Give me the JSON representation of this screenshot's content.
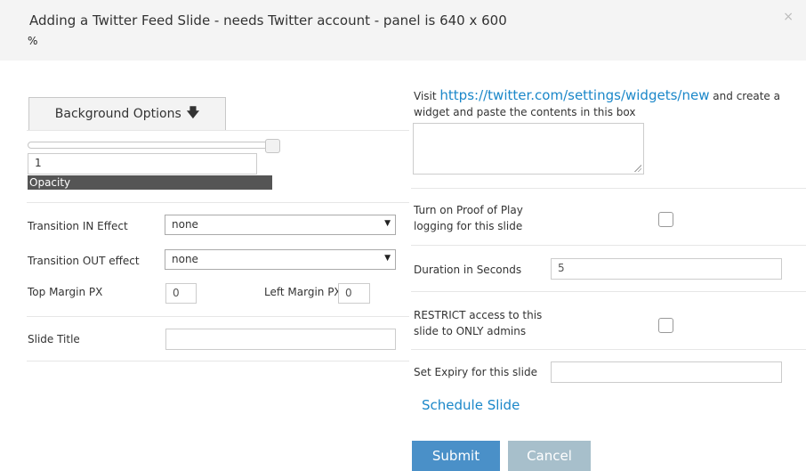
{
  "header": {
    "title": "Adding a Twitter Feed Slide - needs Twitter account - panel is 640 x 600",
    "link_icon": "%",
    "close": "×"
  },
  "left": {
    "background_button": "Background Options",
    "background_arrow": "🡇",
    "opacity_value": "1",
    "opacity_label": "Opacity",
    "opacity_level": 1,
    "transition_in_label": "Transition IN Effect",
    "transition_in_value": "none",
    "transition_out_label": "Transition OUT effect",
    "transition_out_value": "none",
    "top_margin_label": "Top Margin PX",
    "top_margin_value": "0",
    "left_margin_label": "Left Margin PX",
    "left_margin_value": "0",
    "slide_title_label": "Slide Title",
    "slide_title_value": ""
  },
  "right": {
    "visit_prefix": "Visit",
    "visit_url": "https://twitter.com/settings/widgets/new",
    "visit_suffix": "and create a widget and paste the contents in this box",
    "widget_code": "",
    "proof_label_1": "Turn on Proof of Play",
    "proof_label_2": "logging for this slide",
    "proof_checked": false,
    "duration_label": "Duration in Seconds",
    "duration_value": "5",
    "restrict_label_1": "RESTRICT access to this",
    "restrict_label_2": "slide to ONLY admins",
    "restrict_checked": false,
    "expiry_label": "Set Expiry for this slide",
    "expiry_value": "",
    "schedule_link": "Schedule Slide"
  },
  "actions": {
    "submit": "Submit",
    "cancel": "Cancel"
  },
  "colors": {
    "link": "#1a87c9",
    "submit_bg": "#4a90c8",
    "cancel_bg": "#a7bfcb",
    "opacity_label_bg": "#555555"
  }
}
